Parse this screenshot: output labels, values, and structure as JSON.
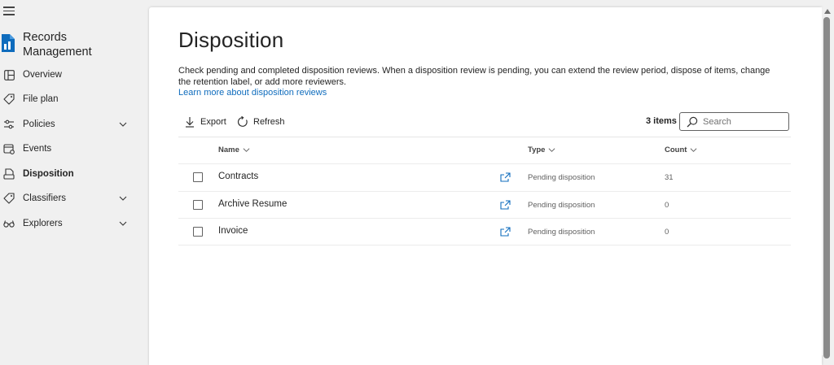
{
  "nav": {
    "app_title": "Records Management",
    "items": [
      {
        "label": "Overview",
        "icon": "overview-icon",
        "expandable": false,
        "active": false
      },
      {
        "label": "File plan",
        "icon": "tag-icon",
        "expandable": false,
        "active": false
      },
      {
        "label": "Policies",
        "icon": "sliders-icon",
        "expandable": true,
        "active": false
      },
      {
        "label": "Events",
        "icon": "events-icon",
        "expandable": false,
        "active": false
      },
      {
        "label": "Disposition",
        "icon": "disposition-icon",
        "expandable": false,
        "active": true
      },
      {
        "label": "Classifiers",
        "icon": "tag-icon",
        "expandable": true,
        "active": false
      },
      {
        "label": "Explorers",
        "icon": "glasses-icon",
        "expandable": true,
        "active": false
      }
    ]
  },
  "page": {
    "title": "Disposition",
    "description": "Check pending and completed disposition reviews. When a disposition review is pending, you can extend the review period, dispose of items, change the retention label, or add more reviewers.",
    "learn_link": "Learn more about disposition reviews"
  },
  "toolbar": {
    "export_label": "Export",
    "refresh_label": "Refresh",
    "items_count": "3 items",
    "search_placeholder": "Search"
  },
  "table": {
    "columns": {
      "name": "Name",
      "type": "Type",
      "count": "Count"
    },
    "rows": [
      {
        "name": "Contracts",
        "type": "Pending disposition",
        "count": "31"
      },
      {
        "name": "Archive Resume",
        "type": "Pending disposition",
        "count": "0"
      },
      {
        "name": "Invoice",
        "type": "Pending disposition",
        "count": "0"
      }
    ]
  },
  "colors": {
    "accent": "#0f6cbd",
    "text": "#242424",
    "muted": "#616161",
    "nav_background": "#f0f0f0"
  }
}
